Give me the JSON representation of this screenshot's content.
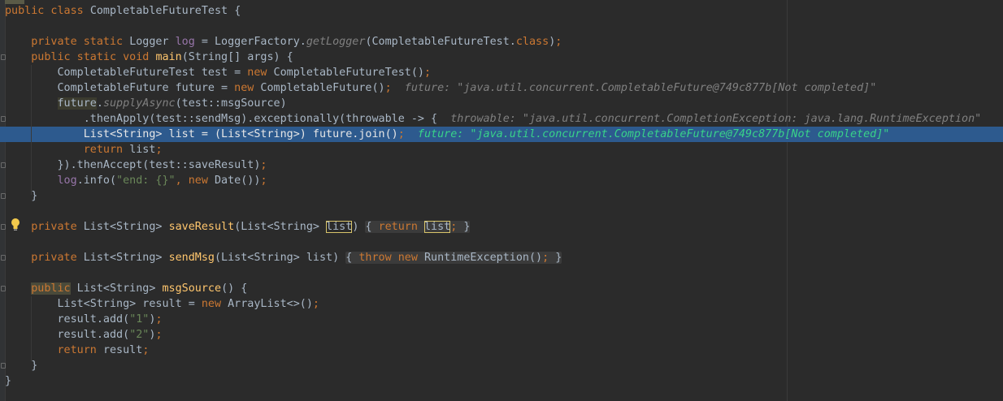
{
  "editor": {
    "lines": [
      {
        "id": "l1",
        "text": "public class CompletableFutureTest {"
      },
      {
        "id": "l2",
        "text": ""
      },
      {
        "id": "l3",
        "text": "    private static Logger log = LoggerFactory.getLogger(CompletableFutureTest.class);"
      },
      {
        "id": "l4",
        "text": "    public static void main(String[] args) {"
      },
      {
        "id": "l5",
        "text": "        CompletableFutureTest test = new CompletableFutureTest();"
      },
      {
        "id": "l6",
        "text": "        CompletableFuture future = new CompletableFuture();",
        "hint": "future: \"java.util.concurrent.CompletableFuture@749c877b[Not completed]\""
      },
      {
        "id": "l7",
        "text": "        future.supplyAsync(test::msgSource)"
      },
      {
        "id": "l8",
        "text": "            .thenApply(test::sendMsg).exceptionally(throwable -> {",
        "hint": "throwable: \"java.util.concurrent.CompletionException: java.lang.RuntimeException\""
      },
      {
        "id": "l9",
        "text": "            List<String> list = (List<String>) future.join();",
        "hint": "future: \"java.util.concurrent.CompletableFuture@749c877b[Not completed]\""
      },
      {
        "id": "l10",
        "text": "            return list;"
      },
      {
        "id": "l11",
        "text": "        }).thenAccept(test::saveResult);"
      },
      {
        "id": "l12",
        "text": "        log.info(\"end: {}\", new Date());"
      },
      {
        "id": "l13",
        "text": "    }"
      },
      {
        "id": "l14",
        "text": ""
      },
      {
        "id": "l15",
        "text": "    private List<String> saveResult(List<String> list) { return list; }"
      },
      {
        "id": "l16",
        "text": ""
      },
      {
        "id": "l17",
        "text": "    private List<String> sendMsg(List<String> list) { throw new RuntimeException(); }"
      },
      {
        "id": "l18",
        "text": ""
      },
      {
        "id": "l19",
        "text": "    public List<String> msgSource() {"
      },
      {
        "id": "l20",
        "text": "        List<String> result = new ArrayList<>();"
      },
      {
        "id": "l21",
        "text": "        result.add(\"1\");"
      },
      {
        "id": "l22",
        "text": "        result.add(\"2\");"
      },
      {
        "id": "l23",
        "text": "        return result;"
      },
      {
        "id": "l24",
        "text": "    }"
      },
      {
        "id": "l25",
        "text": "}"
      }
    ],
    "current_line": "l9",
    "icons": [
      "fold-icon",
      "intention-bulb-icon"
    ],
    "colors": {
      "background": "#2b2b2b",
      "keyword": "#cc7832",
      "field": "#9876aa",
      "method": "#ffc66d",
      "string": "#6a8759",
      "hint": "#808080",
      "current_line": "#2d5a8e",
      "hint_current": "#39d389"
    }
  }
}
